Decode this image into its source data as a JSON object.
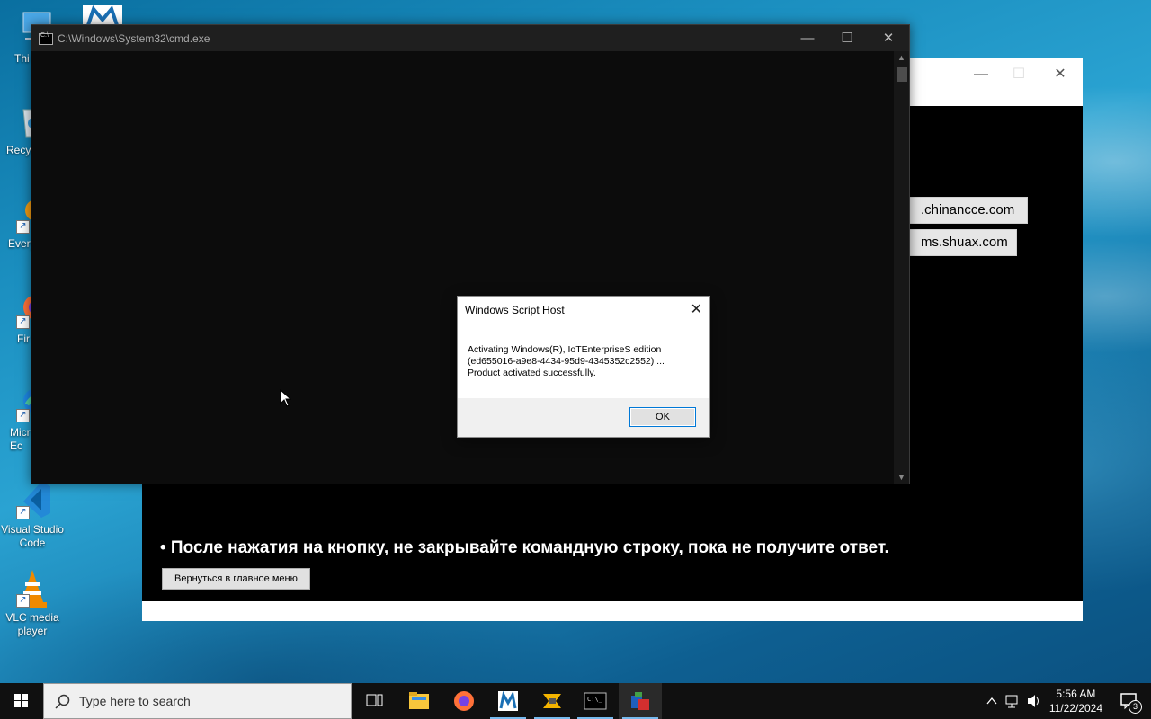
{
  "desktop": {
    "icons": [
      {
        "label": "Thi",
        "icon": "this-pc-icon"
      },
      {
        "label": "Recy",
        "icon": "recycle-bin-icon"
      },
      {
        "label": "Every",
        "icon": "everything-icon"
      },
      {
        "label": "Fir",
        "icon": "firefox-icon"
      },
      {
        "label": "Micr\nEc",
        "icon": "edge-icon"
      },
      {
        "label": "Visual Studio Code",
        "icon": "vscode-icon"
      },
      {
        "label": "VLC media player",
        "icon": "vlc-icon"
      }
    ]
  },
  "bg_window": {
    "server_buttons": [
      ".chinancce.com",
      "ms.shuax.com"
    ],
    "note": "• После нажатия на кнопку, не закрывайте командную строку, пока не получите ответ.",
    "back_button": "Вернуться в главное меню"
  },
  "cmd": {
    "title": "C:\\Windows\\System32\\cmd.exe"
  },
  "msgbox": {
    "title": "Windows Script Host",
    "text": "Activating Windows(R), IoTEnterpriseS edition\n(ed655016-a9e8-4434-95d9-4345352c2552) ...\nProduct activated successfully.",
    "ok_label": "OK"
  },
  "taskbar": {
    "search_placeholder": "Type here to search",
    "time": "5:56 AM",
    "date": "11/22/2024",
    "notification_count": "3",
    "accent": "#76b9ed"
  }
}
